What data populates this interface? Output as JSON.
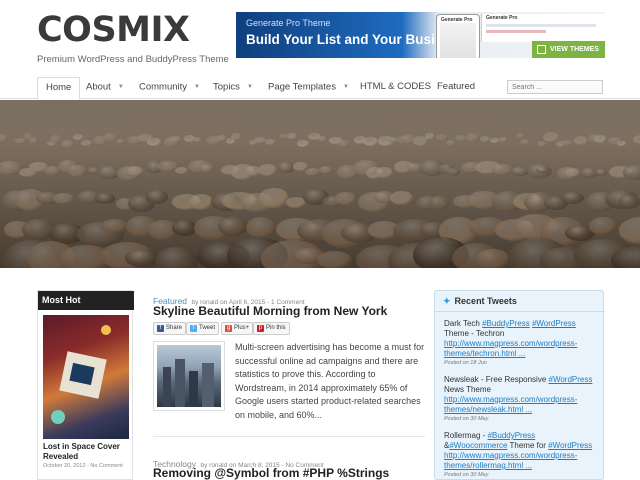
{
  "site": {
    "logo": "COSMIX",
    "tagline": "Premium WordPress and BuddyPress Theme"
  },
  "ad": {
    "top_text": "Generate Pro Theme",
    "headline": "Build Your List and Your Business",
    "phone_label": "Generate Pro",
    "preview_label": "Generate Pro",
    "button": "VIEW THEMES"
  },
  "nav": {
    "items": [
      {
        "label": "Home",
        "active": true
      },
      {
        "label": "About",
        "caret": true
      },
      {
        "label": "Community",
        "caret": true
      },
      {
        "label": "Topics",
        "caret": true
      },
      {
        "label": "Page Templates",
        "caret": true
      },
      {
        "label": "HTML & CODES"
      },
      {
        "label": "Featured"
      }
    ],
    "caret_glyph": "▼",
    "search_placeholder": "Search ..."
  },
  "sidebar": {
    "widget_title": "Most Hot",
    "post_title": "Lost in Space Cover Revealed",
    "post_date": "October 20, 2012",
    "post_comments": "No Comment"
  },
  "posts": [
    {
      "category": "Featured",
      "by": "by",
      "author": "ronald",
      "on": "on",
      "date": "April 6, 2015",
      "comments": "1 Comment",
      "title": "Skyline Beautiful Morning from New York",
      "excerpt": "Multi-screen advertising has become a must for successful online ad campaigns and there are statistics to prove this. According to Wordstream, in 2014 approximately 65% of Google users started product-related searches on mobile, and 60%..."
    },
    {
      "category": "Technology",
      "by": "by",
      "author": "ronald",
      "on": "on",
      "date": "March 8, 2015",
      "comments": "No Comment",
      "title": "Removing @Symbol from #PHP %Strings"
    }
  ],
  "share": {
    "buttons": [
      {
        "label": "Share",
        "icon": "facebook-icon",
        "color": "#3b5998",
        "glyph": "f"
      },
      {
        "label": "Tweet",
        "icon": "twitter-icon",
        "color": "#55acee",
        "glyph": "t"
      },
      {
        "label": "Plus+",
        "icon": "google-plus-icon",
        "color": "#dd4b39",
        "glyph": "g"
      },
      {
        "label": "Pin this",
        "icon": "pinterest-icon",
        "color": "#cb2027",
        "glyph": "p"
      }
    ]
  },
  "tweets": {
    "title": "Recent Tweets",
    "items": [
      {
        "prefix": "Dark Tech",
        "tags": [
          "#BuddyPress",
          "#WordPress"
        ],
        "suffix": "Theme - Techron",
        "url": "http://www.magpress.com/wordpress-themes/techron.html ...",
        "date": "Posted on 18 Jun"
      },
      {
        "prefix": "Newsleak - Free Responsive",
        "tags": [
          "#WordPress"
        ],
        "suffix": "News Theme",
        "url": "http://www.magpress.com/wordpress-themes/newsleak.html ...",
        "date": "Posted on 30 May"
      },
      {
        "prefix": "Rollermag -",
        "tags": [
          "#BuddyPress",
          "#Woocommerce",
          "#WordPress"
        ],
        "url": "http://www.magpress.com/wordpress-themes/rollermag.html ...",
        "date": "Posted on 30 May"
      }
    ]
  },
  "colors": {
    "accent_link": "#1f7cc0",
    "category": "#4a8fb8",
    "ad_button": "#7cb342"
  }
}
